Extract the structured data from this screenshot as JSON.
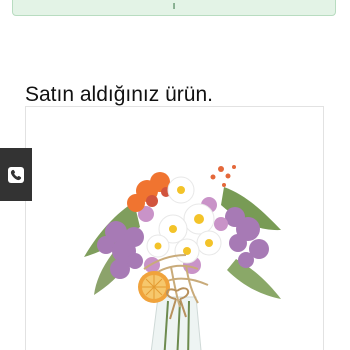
{
  "notice": {
    "text": "ı"
  },
  "purchase": {
    "title": "Satın aldığınız ürün."
  },
  "icons": {
    "call": "phone-icon"
  },
  "colors": {
    "notice_background": "#e3f3e6",
    "call_button": "#333333"
  }
}
